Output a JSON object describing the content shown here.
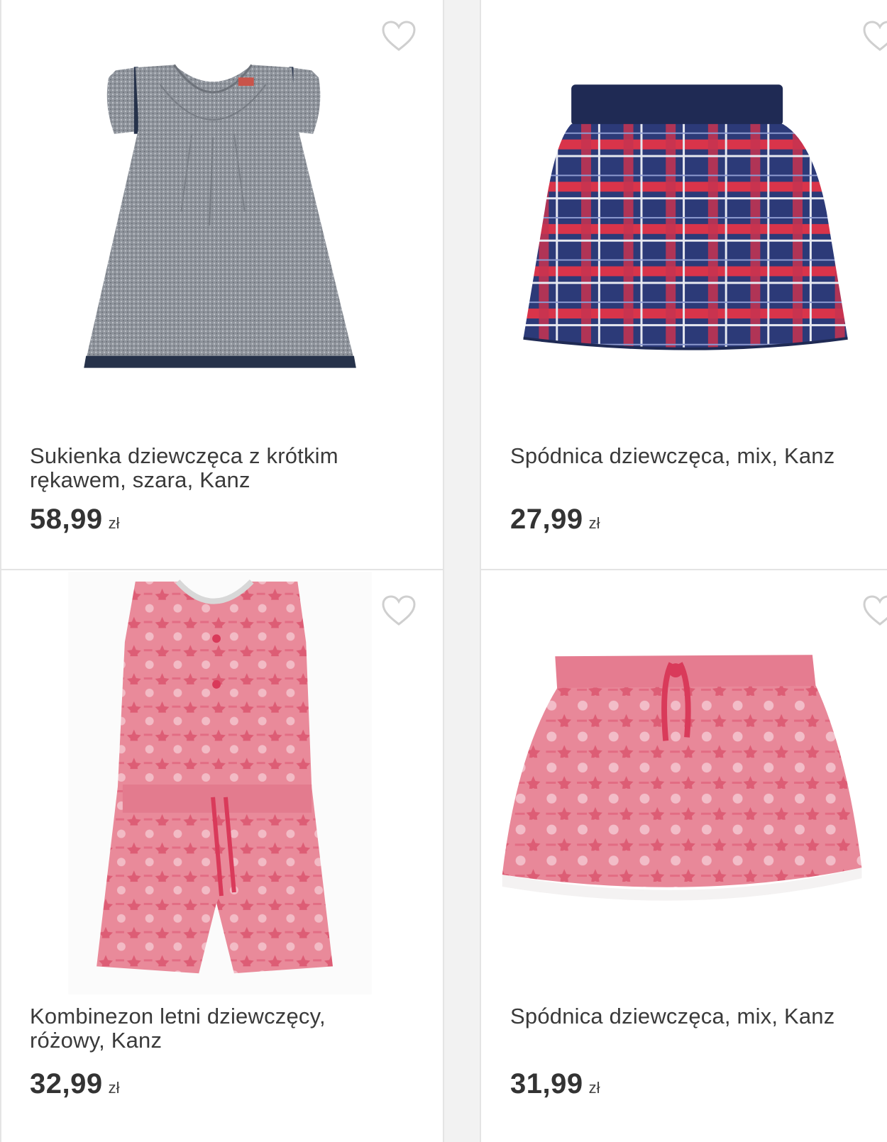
{
  "products": [
    {
      "title": "Sukienka dziewczęca z krótkim rękawem, szara, Kanz",
      "price": "58,99",
      "currency": "zł",
      "image": "grey-dress"
    },
    {
      "title": "Spódnica dziewczęca, mix, Kanz",
      "price": "27,99",
      "currency": "zł",
      "image": "plaid-skirt"
    },
    {
      "title": "Kombinezon letni dziewczęcy, różowy, Kanz",
      "price": "32,99",
      "currency": "zł",
      "image": "pink-romper"
    },
    {
      "title": "Spódnica dziewczęca, mix, Kanz",
      "price": "31,99",
      "currency": "zł",
      "image": "pink-skirt"
    }
  ],
  "icons": {
    "favorite": "heart-outline-icon"
  },
  "colors": {
    "text": "#3a3a3a",
    "price": "#333333",
    "border": "#e4e4e4",
    "heart": "#cfcfcf"
  }
}
